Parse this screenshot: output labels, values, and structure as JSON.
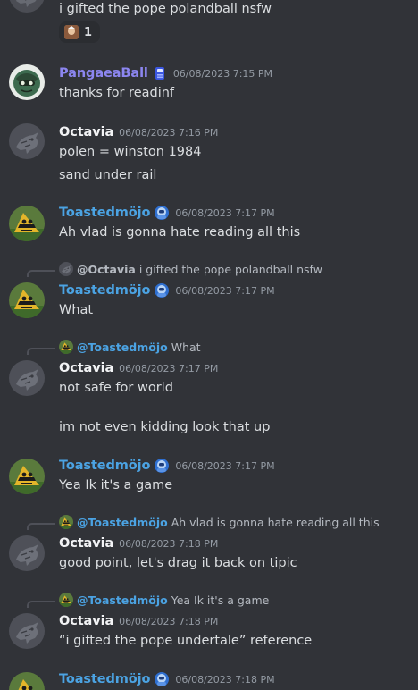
{
  "colors": {
    "background": "#313338",
    "pangaea": "#8c86f0",
    "toasted": "#4ba3e3",
    "octavia": "#f2f3f5",
    "timestamp": "#949ba4"
  },
  "messages": [
    {
      "kind": "continuation",
      "lines": [
        "i gifted the pope polandball nsfw"
      ],
      "reaction": {
        "emoji": "pope-emoji",
        "count": "1"
      }
    },
    {
      "kind": "message",
      "user": "PangaeaBall",
      "badge": "blue-cup-icon",
      "timestamp": "06/08/2023 7:15 PM",
      "lines": [
        "thanks for readinf"
      ]
    },
    {
      "kind": "message",
      "user": "Octavia",
      "timestamp": "06/08/2023 7:16 PM",
      "lines": [
        "polen = winston 1984",
        "sand under rail"
      ]
    },
    {
      "kind": "message",
      "user": "Toastedmöjo",
      "badge": "astronaut-icon",
      "timestamp": "06/08/2023 7:17 PM",
      "lines": [
        "Ah vlad is gonna hate reading all this"
      ]
    },
    {
      "kind": "reply",
      "reply_to": {
        "mention": "@Octavia",
        "text": "i gifted the pope polandball nsfw"
      },
      "user": "Toastedmöjo",
      "badge": "astronaut-icon",
      "timestamp": "06/08/2023 7:17 PM",
      "lines": [
        "What"
      ]
    },
    {
      "kind": "reply",
      "reply_to": {
        "mention": "@Toastedmöjo",
        "text": "What"
      },
      "user": "Octavia",
      "timestamp": "06/08/2023 7:17 PM",
      "lines": [
        "not safe for world",
        "",
        "im not even kidding look that up"
      ]
    },
    {
      "kind": "message",
      "user": "Toastedmöjo",
      "badge": "astronaut-icon",
      "timestamp": "06/08/2023 7:17 PM",
      "lines": [
        "Yea Ik it's a game"
      ]
    },
    {
      "kind": "reply",
      "reply_to": {
        "mention": "@Toastedmöjo",
        "text": "Ah vlad is gonna hate reading all this"
      },
      "user": "Octavia",
      "timestamp": "06/08/2023 7:18 PM",
      "lines": [
        "good point, let's drag it back on tipic"
      ]
    },
    {
      "kind": "reply",
      "reply_to": {
        "mention": "@Toastedmöjo",
        "text": "Yea Ik it's a game"
      },
      "user": "Octavia",
      "timestamp": "06/08/2023 7:18 PM",
      "lines": [
        "“i gifted the pope undertale” reference"
      ]
    },
    {
      "kind": "message",
      "user": "Toastedmöjo",
      "badge": "astronaut-icon",
      "timestamp": "06/08/2023 7:18 PM",
      "lines": []
    }
  ]
}
